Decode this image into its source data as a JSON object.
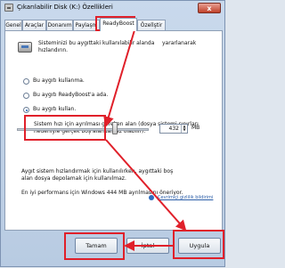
{
  "window": {
    "title": "Çıkarılabilir Disk (K:) Özellikleri",
    "close_label": "x"
  },
  "tabs": [
    {
      "label": "Genel"
    },
    {
      "label": "Araçlar"
    },
    {
      "label": "Donanım"
    },
    {
      "label": "Paylaşm"
    },
    {
      "label": "ReadyBoost"
    },
    {
      "label": "Özellştir"
    }
  ],
  "readyboost": {
    "intro_line1": "Sisteminizi bu aygıttaki kullanılabilir alanda",
    "intro_line1b": "yararlanarak",
    "intro_line2": "hızlandırın.",
    "options": [
      {
        "label": "Bu aygıtı kullanma.",
        "selected": false
      },
      {
        "label": "Bu aygıtı ReadyBoost'a ada.",
        "selected": false
      },
      {
        "label": "Bu aygıtı kullan.",
        "selected": true
      }
    ],
    "reserve_line1": "Sistem hızı için ayrılması gereken alan (dosya sistemi sınırları",
    "reserve_line2": "nedeniyle gerçek boş alandan az olabilir):",
    "size_value": "432",
    "size_unit": "MB",
    "slider_fraction": 0.74,
    "info1_line1": "Aygıt sistem hızlandırmak için kullanılırken, aygıttaki boş",
    "info1_line2": "alan dosya depolamak için kullanılmaz.",
    "info2": "En iyi performans için Windows 444 MB ayrılmasını öneriyor.",
    "link": "Çevrimiçi gizlilik bildirimi"
  },
  "buttons": {
    "ok": "Tamam",
    "cancel": "İptal",
    "apply": "Uygula"
  },
  "colors": {
    "annotation_red": "#e0202a",
    "link_blue": "#2c5ea8"
  }
}
